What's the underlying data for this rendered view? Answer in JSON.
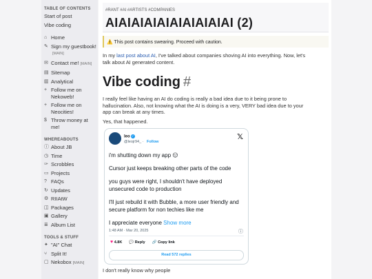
{
  "sidebar": {
    "toc_head": "TABLE OF CONTENTS",
    "toc": [
      "Start of post",
      "Vibe coding"
    ],
    "nav": [
      {
        "icon": "home-icon",
        "glyph": "⌂",
        "label": "Home",
        "tag": ""
      },
      {
        "icon": "pencil-icon",
        "glyph": "✎",
        "label": "Sign my guestbook!",
        "tag": "[MAIN]"
      },
      {
        "icon": "mail-icon",
        "glyph": "✉",
        "label": "Contact me!",
        "tag": "[MAIN]"
      },
      {
        "icon": "sitemap-icon",
        "glyph": "▤",
        "label": "Sitemap",
        "tag": ""
      },
      {
        "icon": "chart-icon",
        "glyph": "▥",
        "label": "Analytical",
        "tag": ""
      },
      {
        "icon": "plus-icon",
        "glyph": "+",
        "label": "Follow me on Nekoweb!",
        "tag": ""
      },
      {
        "icon": "plus-icon",
        "glyph": "+",
        "label": "Follow me on Neocities!",
        "tag": ""
      },
      {
        "icon": "money-icon",
        "glyph": "$",
        "label": "Throw money at me!",
        "tag": ""
      }
    ],
    "where_head": "WHEREABOUTS",
    "where": [
      {
        "icon": "info-icon",
        "glyph": "ⓘ",
        "label": "About JB"
      },
      {
        "icon": "clock-icon",
        "glyph": "◷",
        "label": "Time"
      },
      {
        "icon": "scribble-icon",
        "glyph": "✑",
        "label": "Scrobbles"
      },
      {
        "icon": "folder-icon",
        "glyph": "▭",
        "label": "Projects"
      },
      {
        "icon": "faq-icon",
        "glyph": "?",
        "label": "FAQs"
      },
      {
        "icon": "refresh-icon",
        "glyph": "↻",
        "label": "Updates"
      },
      {
        "icon": "gear-icon",
        "glyph": "⚙",
        "label": "RIIAtW"
      },
      {
        "icon": "package-icon",
        "glyph": "◫",
        "label": "Packages"
      },
      {
        "icon": "image-icon",
        "glyph": "▣",
        "label": "Gallery"
      },
      {
        "icon": "list-icon",
        "glyph": "≣",
        "label": "Album List"
      }
    ],
    "tools_head": "TOOLS & STUFF",
    "tools": [
      {
        "icon": "ai-icon",
        "glyph": "✦",
        "label": "\"AI\" Chat",
        "tag": ""
      },
      {
        "icon": "split-icon",
        "glyph": "⑂",
        "label": "Split It!",
        "tag": ""
      },
      {
        "icon": "box-icon",
        "glyph": "▢",
        "label": "Nekobox",
        "tag": "[MAIN]"
      }
    ]
  },
  "header": {
    "tags": "#RANT #AI #ARTISTS #COMPANIES",
    "title": "AIAIAIAIAIAIAIAIAIAI (2)"
  },
  "warning": {
    "icon": "⚠️",
    "text": "This post contains swearing. Proceed with caution."
  },
  "intro": {
    "pre": "In my ",
    "link": "last post about AI",
    "post": ", I've talked about companies shoving AI into everything. Now, let's talk about AI generated content."
  },
  "section": {
    "title": "Vibe coding",
    "anchor": "#"
  },
  "para1": "I really feel like having an AI do coding is really a bad idea due to it being prone to hallucination. Also, not knowing what the AI is doing is a very, VERY bad idea due to your app can break at any times.",
  "para2": "Yes, that happened.",
  "tweet": {
    "name": "leo",
    "handle": "@leojr94_",
    "follow": "Follow",
    "lines": [
      "i'm shutting down my app 😑",
      "Cursor just keeps breaking other parts of the code",
      "you guys were right, I shouldn't have deployed unsecured code to production",
      "I'll just rebuild it with Bubble, a more user friendly and secure platform for non techies like me",
      "I appreciate everyone"
    ],
    "show_more": "Show more",
    "meta": "1:48 AM · Mar 20, 2025",
    "likes": "4.8K",
    "reply": "Reply",
    "copy": "Copy link",
    "read_replies": "Read 572 replies"
  },
  "bottom_text": "I don't really know why people"
}
